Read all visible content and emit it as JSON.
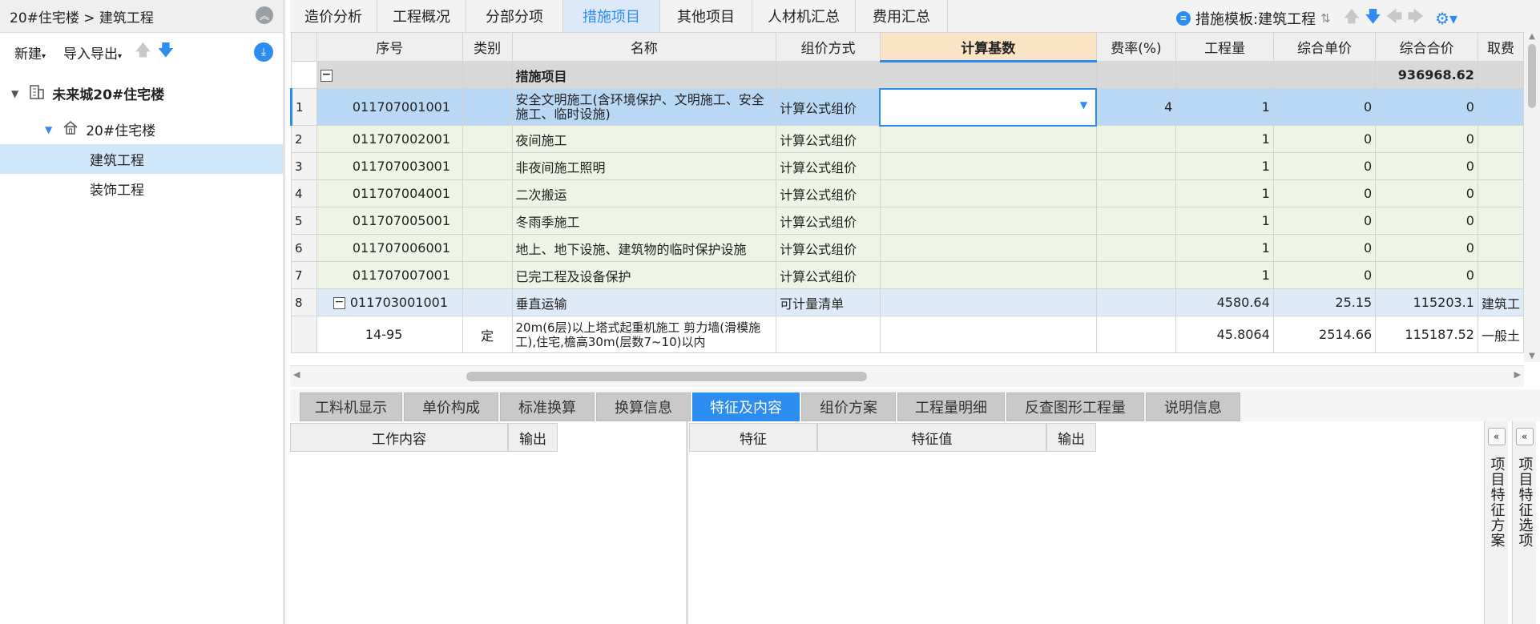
{
  "left_panel": {
    "header_title": "20#住宅楼 > 建筑工程",
    "toolbar": {
      "new_label": "新建",
      "import_export_label": "导入导出"
    },
    "tree": {
      "root": "未来城20#住宅楼",
      "child": "20#住宅楼",
      "items": [
        "建筑工程",
        "装饰工程"
      ],
      "selected": "建筑工程"
    }
  },
  "top_tabs": [
    "造价分析",
    "工程概况",
    "分部分项",
    "措施项目",
    "其他项目",
    "人材机汇总",
    "费用汇总"
  ],
  "active_tab": "措施项目",
  "template_label": "措施模板:建筑工程",
  "grid": {
    "columns": [
      "序号",
      "类别",
      "名称",
      "组价方式",
      "计算基数",
      "费率(%)",
      "工程量",
      "综合单价",
      "综合合价",
      "取费"
    ],
    "group_row": {
      "name": "措施项目",
      "total": "936968.62"
    },
    "rows": [
      {
        "no": "1",
        "code": "011707001001",
        "type": "",
        "name": "安全文明施工(含环境保护、文明施工、安全施工、临时设施)",
        "method": "计算公式组价",
        "base": "",
        "rate": "4",
        "qty": "1",
        "unit_price": "0",
        "total": "0",
        "fee": ""
      },
      {
        "no": "2",
        "code": "011707002001",
        "type": "",
        "name": "夜间施工",
        "method": "计算公式组价",
        "base": "",
        "rate": "",
        "qty": "1",
        "unit_price": "0",
        "total": "0",
        "fee": ""
      },
      {
        "no": "3",
        "code": "011707003001",
        "type": "",
        "name": "非夜间施工照明",
        "method": "计算公式组价",
        "base": "",
        "rate": "",
        "qty": "1",
        "unit_price": "0",
        "total": "0",
        "fee": ""
      },
      {
        "no": "4",
        "code": "011707004001",
        "type": "",
        "name": "二次搬运",
        "method": "计算公式组价",
        "base": "",
        "rate": "",
        "qty": "1",
        "unit_price": "0",
        "total": "0",
        "fee": ""
      },
      {
        "no": "5",
        "code": "011707005001",
        "type": "",
        "name": "冬雨季施工",
        "method": "计算公式组价",
        "base": "",
        "rate": "",
        "qty": "1",
        "unit_price": "0",
        "total": "0",
        "fee": ""
      },
      {
        "no": "6",
        "code": "011707006001",
        "type": "",
        "name": "地上、地下设施、建筑物的临时保护设施",
        "method": "计算公式组价",
        "base": "",
        "rate": "",
        "qty": "1",
        "unit_price": "0",
        "total": "0",
        "fee": ""
      },
      {
        "no": "7",
        "code": "011707007001",
        "type": "",
        "name": "已完工程及设备保护",
        "method": "计算公式组价",
        "base": "",
        "rate": "",
        "qty": "1",
        "unit_price": "0",
        "total": "0",
        "fee": ""
      },
      {
        "no": "8",
        "code": "011703001001",
        "type": "",
        "name": "垂直运输",
        "method": "可计量清单",
        "base": "",
        "rate": "",
        "qty": "4580.64",
        "unit_price": "25.15",
        "total": "115203.1",
        "fee": "建筑工"
      },
      {
        "no": "",
        "code": "14-95",
        "type": "定",
        "name": "20m(6层)以上塔式起重机施工 剪力墙(滑模施工),住宅,檐高30m(层数7~10)以内",
        "method": "",
        "base": "",
        "rate": "",
        "qty": "45.8064",
        "unit_price": "2514.66",
        "total": "115187.52",
        "fee": "一般土"
      }
    ]
  },
  "bottom_tabs": [
    "工料机显示",
    "单价构成",
    "标准换算",
    "换算信息",
    "特征及内容",
    "组价方案",
    "工程量明细",
    "反查图形工程量",
    "说明信息"
  ],
  "bottom_active": "特征及内容",
  "bottom_left_headers": [
    "工作内容",
    "输出"
  ],
  "bottom_right_headers": [
    "特征",
    "特征值",
    "输出"
  ],
  "side_panels": [
    "项目特征方案",
    "项目特征选项"
  ],
  "colors": {
    "accent": "#2d8cf0",
    "selected_row": "#b9d8f3",
    "item_row": "#eef5e6",
    "header_highlight": "#fbe3c6"
  }
}
